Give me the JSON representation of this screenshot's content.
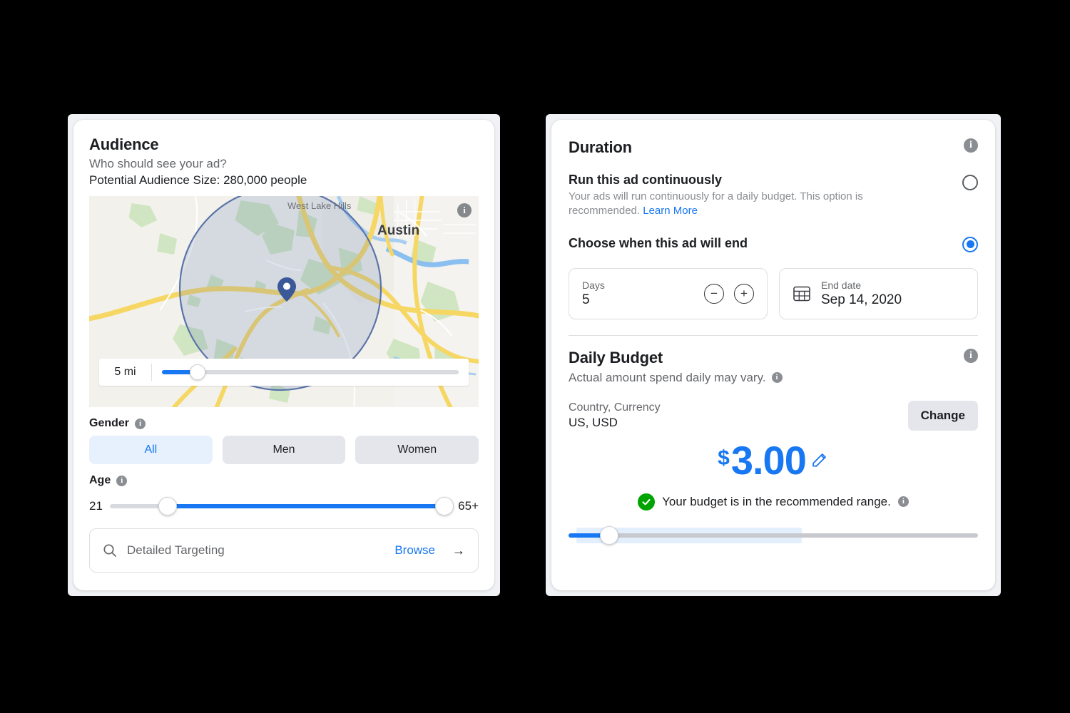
{
  "audience": {
    "title": "Audience",
    "subtitle": "Who should see your ad?",
    "potential_size": "Potential Audience Size: 280,000 people",
    "map": {
      "label_town": "West Lake Hills",
      "label_city": "Austin",
      "info_icon": "info-icon",
      "pin_icon": "map-pin-icon"
    },
    "radius": {
      "value": "5 mi",
      "slider_percent": 12
    },
    "gender": {
      "label": "Gender",
      "options": [
        "All",
        "Men",
        "Women"
      ],
      "selected": "All"
    },
    "age": {
      "label": "Age",
      "min_label": "21",
      "max_label": "65+",
      "min_percent": 17,
      "max_percent": 98
    },
    "detailed_targeting": {
      "placeholder": "Detailed Targeting",
      "browse_label": "Browse",
      "search_icon": "search-icon",
      "arrow_icon": "arrow-right-icon"
    }
  },
  "duration": {
    "title": "Duration",
    "options": [
      {
        "title": "Run this ad continuously",
        "description": "Your ads will run continuously for a daily budget. This option is recommended.",
        "link_label": "Learn More",
        "selected": false
      },
      {
        "title": "Choose when this ad will end",
        "description": "",
        "link_label": "",
        "selected": true
      }
    ],
    "days_field": {
      "label": "Days",
      "value": "5",
      "decrement_label": "−",
      "increment_label": "+"
    },
    "end_date_field": {
      "label": "End date",
      "value": "Sep 14, 2020",
      "icon": "calendar-icon"
    }
  },
  "daily_budget": {
    "title": "Daily Budget",
    "subtitle": "Actual amount spend daily may vary.",
    "country_currency_label": "Country, Currency",
    "country_currency_value": "US, USD",
    "change_label": "Change",
    "currency_symbol": "$",
    "amount": "3.00",
    "edit_icon": "pencil-icon",
    "status_text": "Your budget is in the recommended range.",
    "status_icon": "check-circle-icon",
    "slider": {
      "value_percent": 10,
      "recommended_start_percent": 2,
      "recommended_end_percent": 57
    }
  },
  "colors": {
    "accent_blue": "#1877f2",
    "success_green": "#00a400",
    "page_background": "#000000",
    "card_background": "#ffffff",
    "shell_background": "#f0f2f5",
    "muted_text": "#65676b"
  }
}
